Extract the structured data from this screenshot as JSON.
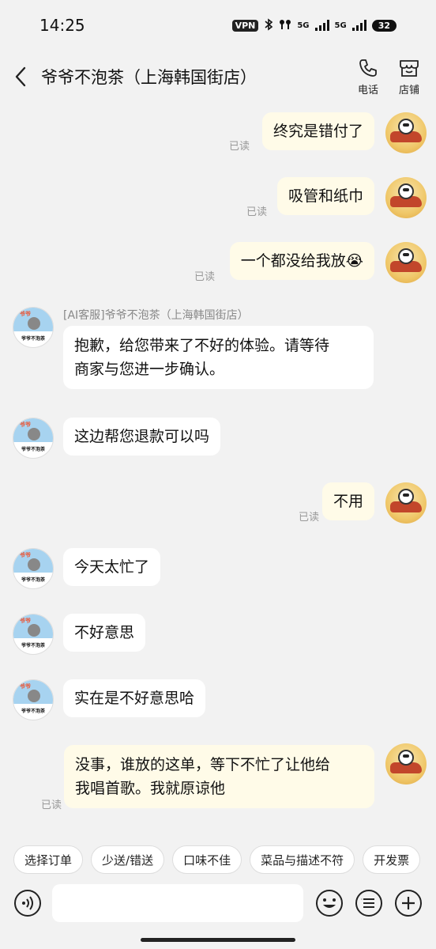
{
  "status_bar": {
    "time": "14:25",
    "vpn": "VPN",
    "net1": "5G",
    "net2": "5G",
    "battery": "32"
  },
  "header": {
    "title": "爷爷不泡茶（上海韩国街店）",
    "phone_label": "电话",
    "store_label": "店铺"
  },
  "read_label": "已读",
  "messages": {
    "m1": "终究是错付了",
    "m2": "吸管和纸巾",
    "m3": "一个都没给我放😭",
    "ai_sender": "[AI客服]爷爷不泡茶（上海韩国街店）",
    "m4_line1": "抱歉，给您带来了不好的体验。请等待",
    "m4_line2": "商家与您进一步确认。",
    "m5": "这边帮您退款可以吗",
    "m6": "不用",
    "m7": "今天太忙了",
    "m8": "不好意思",
    "m9": "实在是不好意思哈",
    "m10_line1": "没事，谁放的这单，等下不忙了让他给",
    "m10_line2": "我唱首歌。我就原谅他"
  },
  "shop_avatar": {
    "brand": "爷爷不泡茶"
  },
  "quick_replies": [
    "选择订单",
    "少送/错送",
    "口味不佳",
    "菜品与描述不符",
    "开发票"
  ],
  "input": {
    "value": ""
  },
  "colors": {
    "background": "#f2f2f2",
    "my_bubble": "#fffbe8",
    "other_bubble": "#ffffff",
    "read_text": "#999999"
  }
}
